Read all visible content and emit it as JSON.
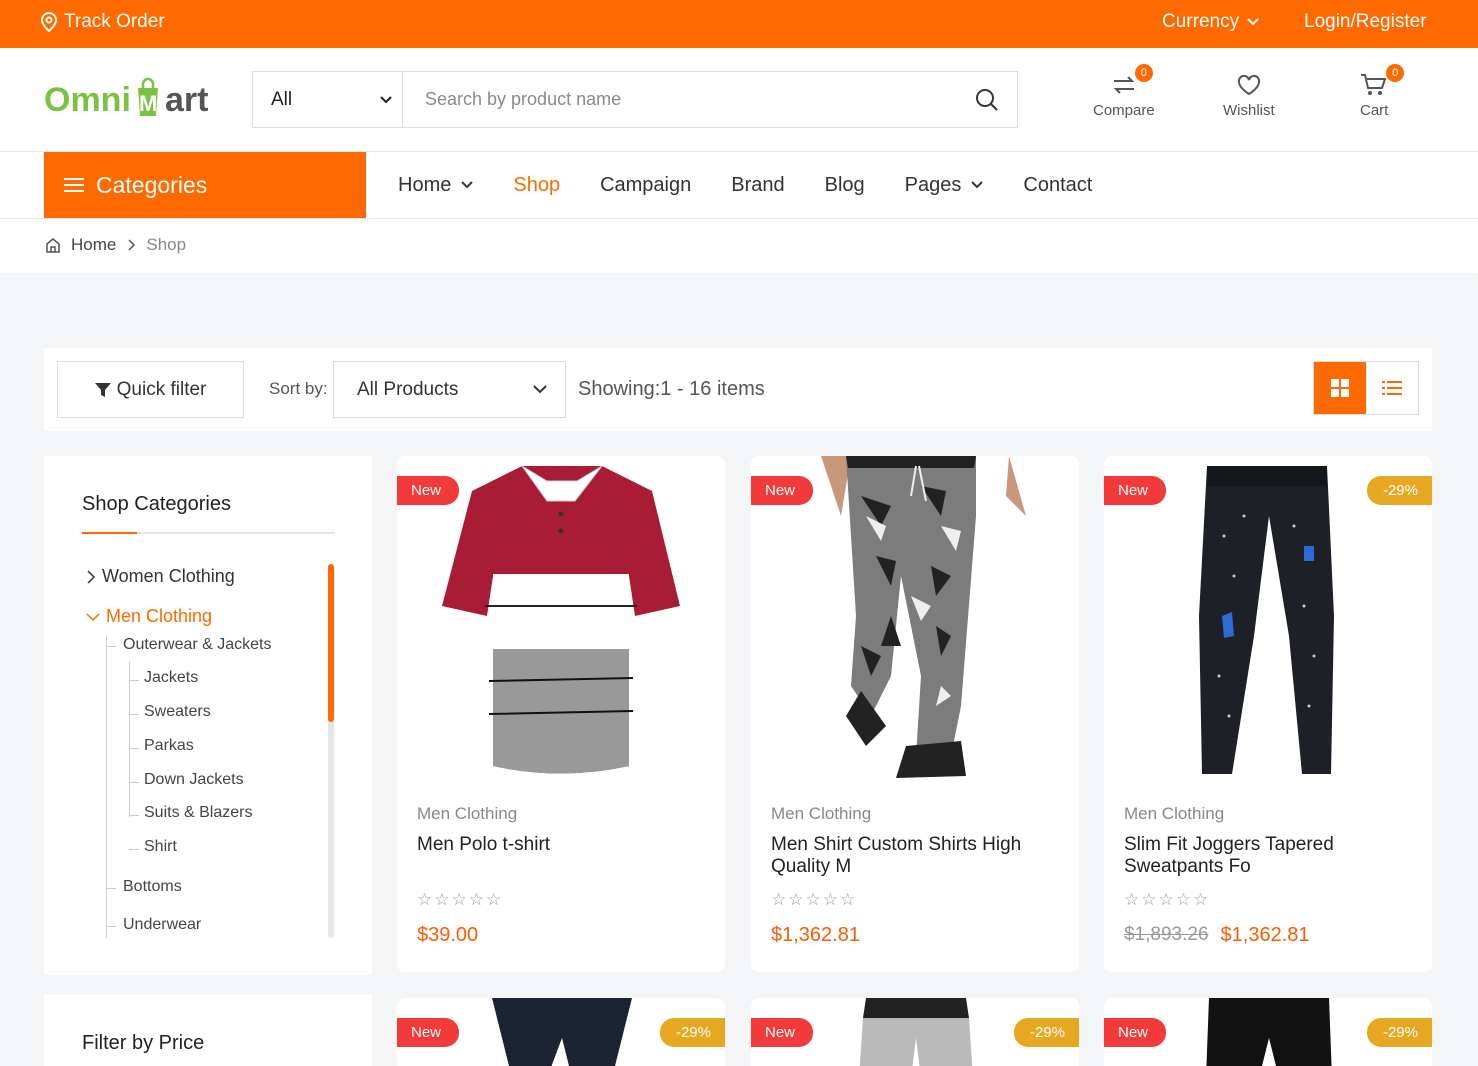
{
  "topbar": {
    "track": "Track Order",
    "currency": "Currency",
    "login": "Login/Register"
  },
  "logo": {
    "text_part1": "Omni",
    "text_part2": "Mart"
  },
  "search": {
    "category": "All",
    "placeholder": "Search by product name"
  },
  "header_icons": {
    "compare": {
      "label": "Compare",
      "count": "0"
    },
    "wishlist": {
      "label": "Wishlist"
    },
    "cart": {
      "label": "Cart",
      "count": "0"
    }
  },
  "categories_button": "Categories",
  "nav": [
    "Home",
    "Shop",
    "Campaign",
    "Brand",
    "Blog",
    "Pages",
    "Contact"
  ],
  "breadcrumb": {
    "home": "Home",
    "current": "Shop"
  },
  "toolbar": {
    "quick_filter": "Quick filter",
    "sort_label": "Sort by:",
    "sort_value": "All Products",
    "showing": "Showing:1 - 16 items"
  },
  "sidebar": {
    "title": "Shop Categories",
    "items": [
      {
        "label": "Women Clothing"
      },
      {
        "label": "Men Clothing"
      },
      {
        "label": "Outerwear & Jackets"
      },
      {
        "label": "Jackets"
      },
      {
        "label": "Sweaters"
      },
      {
        "label": "Parkas"
      },
      {
        "label": "Down Jackets"
      },
      {
        "label": "Suits & Blazers"
      },
      {
        "label": "Shirt"
      },
      {
        "label": "Bottoms"
      },
      {
        "label": "Underwear"
      }
    ],
    "filter_title": "Filter by Price"
  },
  "products": [
    {
      "tag": "New",
      "discount": "",
      "category": "Men Clothing",
      "name": "Men Polo t-shirt",
      "stars": "☆☆☆☆☆",
      "old_price": "",
      "price": "$39.00"
    },
    {
      "tag": "New",
      "discount": "",
      "category": "Men Clothing",
      "name": "Men Shirt Custom Shirts High Quality M",
      "stars": "☆☆☆☆☆",
      "old_price": "",
      "price": "$1,362.81"
    },
    {
      "tag": "New",
      "discount": "-29%",
      "category": "Men Clothing",
      "name": "Slim Fit Joggers Tapered Sweatpants Fo",
      "stars": "☆☆☆☆☆",
      "old_price": "$1,893.26",
      "price": "$1,362.81"
    }
  ],
  "products_row2": [
    {
      "tag": "New",
      "discount": "-29%"
    },
    {
      "tag": "New",
      "discount": "-29%"
    },
    {
      "tag": "New",
      "discount": "-29%"
    }
  ],
  "colors": {
    "accent": "#ff6a00",
    "new_tag": "#f23a3a",
    "discount_tag": "#e7a821",
    "logo_green": "#7bc242"
  }
}
